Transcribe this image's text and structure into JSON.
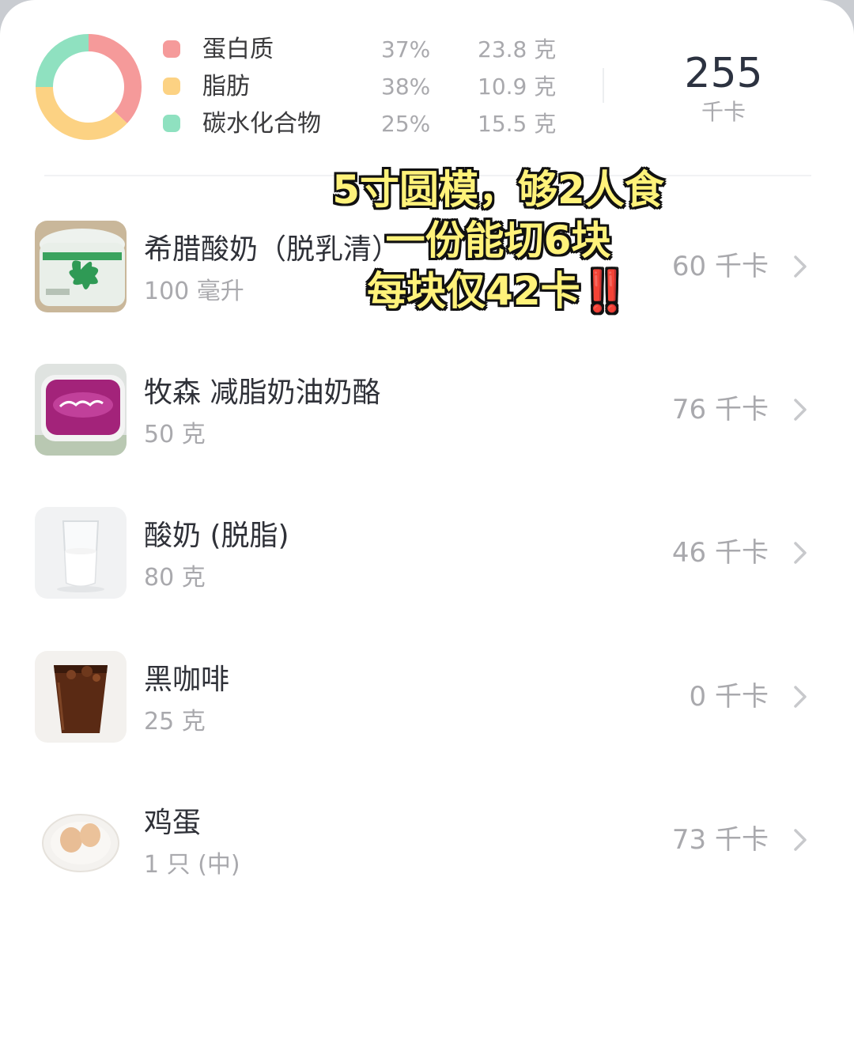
{
  "summary": {
    "macros": [
      {
        "name": "蛋白质",
        "percent": "37%",
        "grams": "23.8 克",
        "color": "#f59a9a"
      },
      {
        "name": "脂肪",
        "percent": "38%",
        "grams": "10.9 克",
        "color": "#fcd283"
      },
      {
        "name": "碳水化合物",
        "percent": "25%",
        "grams": "15.5 克",
        "color": "#8fe1c0"
      }
    ],
    "total_kcal": "255",
    "total_unit": "千卡",
    "donut_fractions": [
      0.37,
      0.38,
      0.25
    ]
  },
  "foods": [
    {
      "name": "希腊酸奶（脱乳清）",
      "amount": "100 毫升",
      "kcal": "60 千卡",
      "image": "yogurt-tub-image"
    },
    {
      "name": "牧森 减脂奶油奶酪",
      "amount": "50 克",
      "kcal": "76 千卡",
      "image": "cream-cheese-tub-image"
    },
    {
      "name": "酸奶 (脱脂)",
      "amount": "80 克",
      "kcal": "46 千卡",
      "image": "glass-of-yogurt-image"
    },
    {
      "name": "黑咖啡",
      "amount": "25 克",
      "kcal": "0 千卡",
      "image": "black-coffee-cup-image"
    },
    {
      "name": "鸡蛋",
      "amount": "1 只 (中)",
      "kcal": "73 千卡",
      "image": "eggs-on-plate-image"
    }
  ],
  "overlay": {
    "line1": "5寸圆模，够2人食",
    "line2": "一份能切6块",
    "line3": "每块仅42卡",
    "line3_emphasis": "‼️"
  }
}
